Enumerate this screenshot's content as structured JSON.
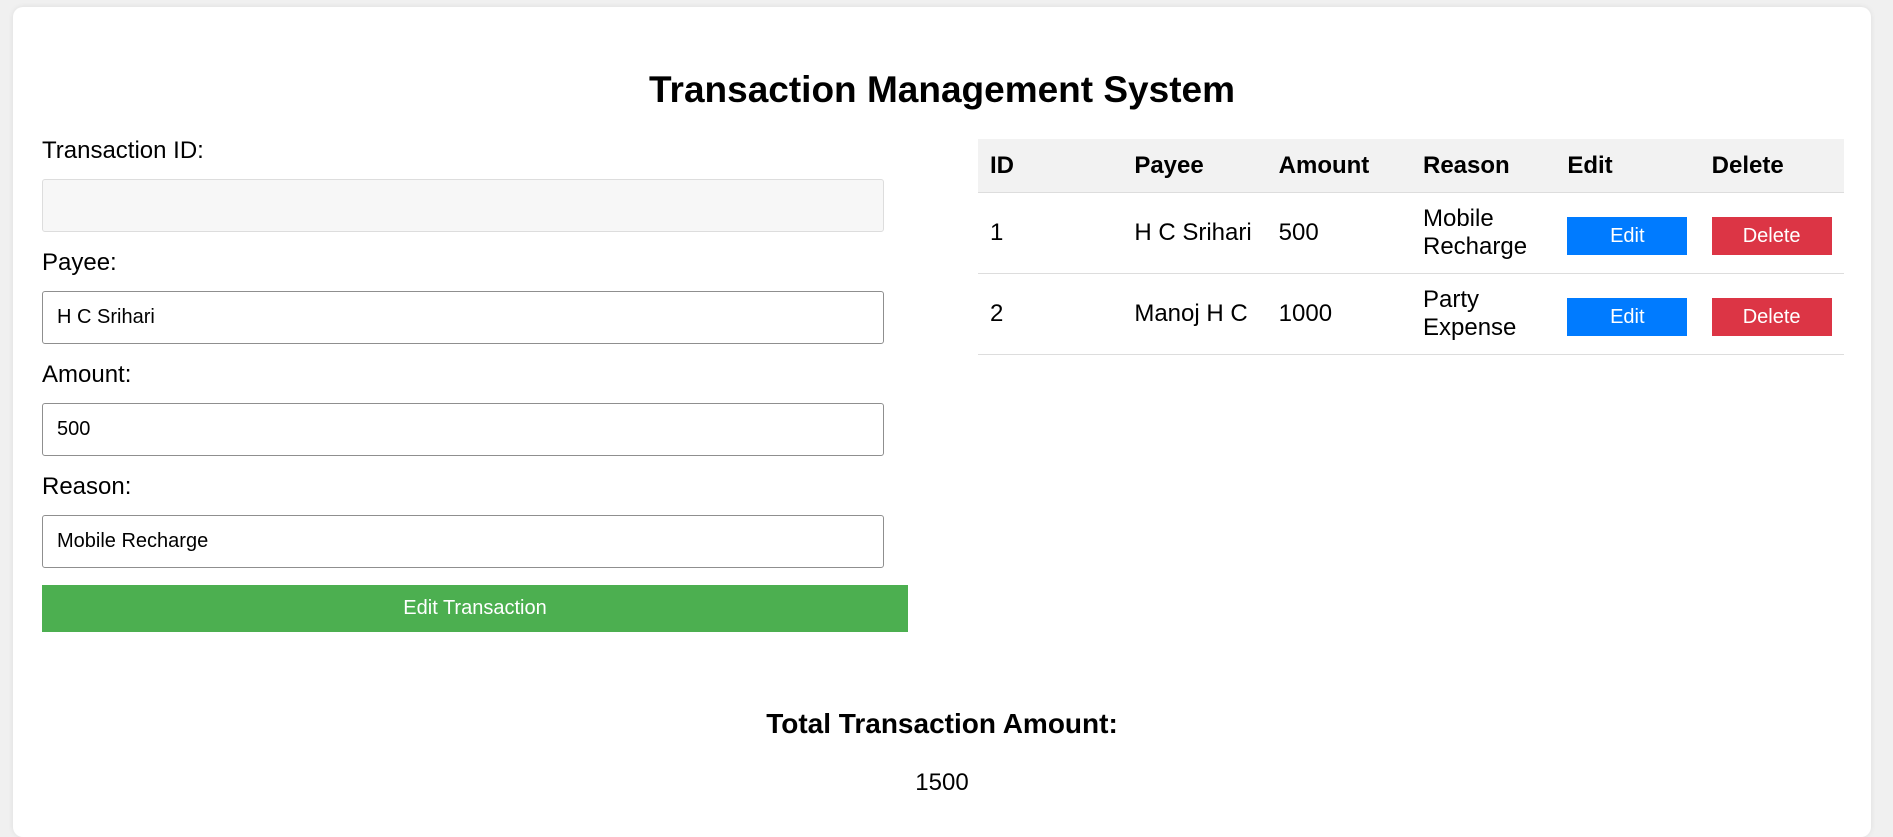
{
  "page": {
    "title": "Transaction Management System"
  },
  "form": {
    "transaction_id": {
      "label": "Transaction ID:",
      "value": ""
    },
    "payee": {
      "label": "Payee:",
      "value": "H C Srihari"
    },
    "amount": {
      "label": "Amount:",
      "value": "500"
    },
    "reason": {
      "label": "Reason:",
      "value": "Mobile Recharge"
    },
    "submit_label": "Edit Transaction"
  },
  "table": {
    "headers": [
      "ID",
      "Payee",
      "Amount",
      "Reason",
      "Edit",
      "Delete"
    ],
    "rows": [
      {
        "id": "1",
        "payee": "H C Srihari",
        "amount": "500",
        "reason": "Mobile Recharge",
        "edit_label": "Edit",
        "delete_label": "Delete"
      },
      {
        "id": "2",
        "payee": "Manoj H C",
        "amount": "1000",
        "reason": "Party Expense",
        "edit_label": "Edit",
        "delete_label": "Delete"
      }
    ]
  },
  "total": {
    "heading": "Total Transaction Amount:",
    "value": "1500"
  },
  "colors": {
    "submit_button": "#4caf50",
    "edit_button": "#007bff",
    "delete_button": "#dc3545",
    "header_background": "#f2f2f2"
  }
}
